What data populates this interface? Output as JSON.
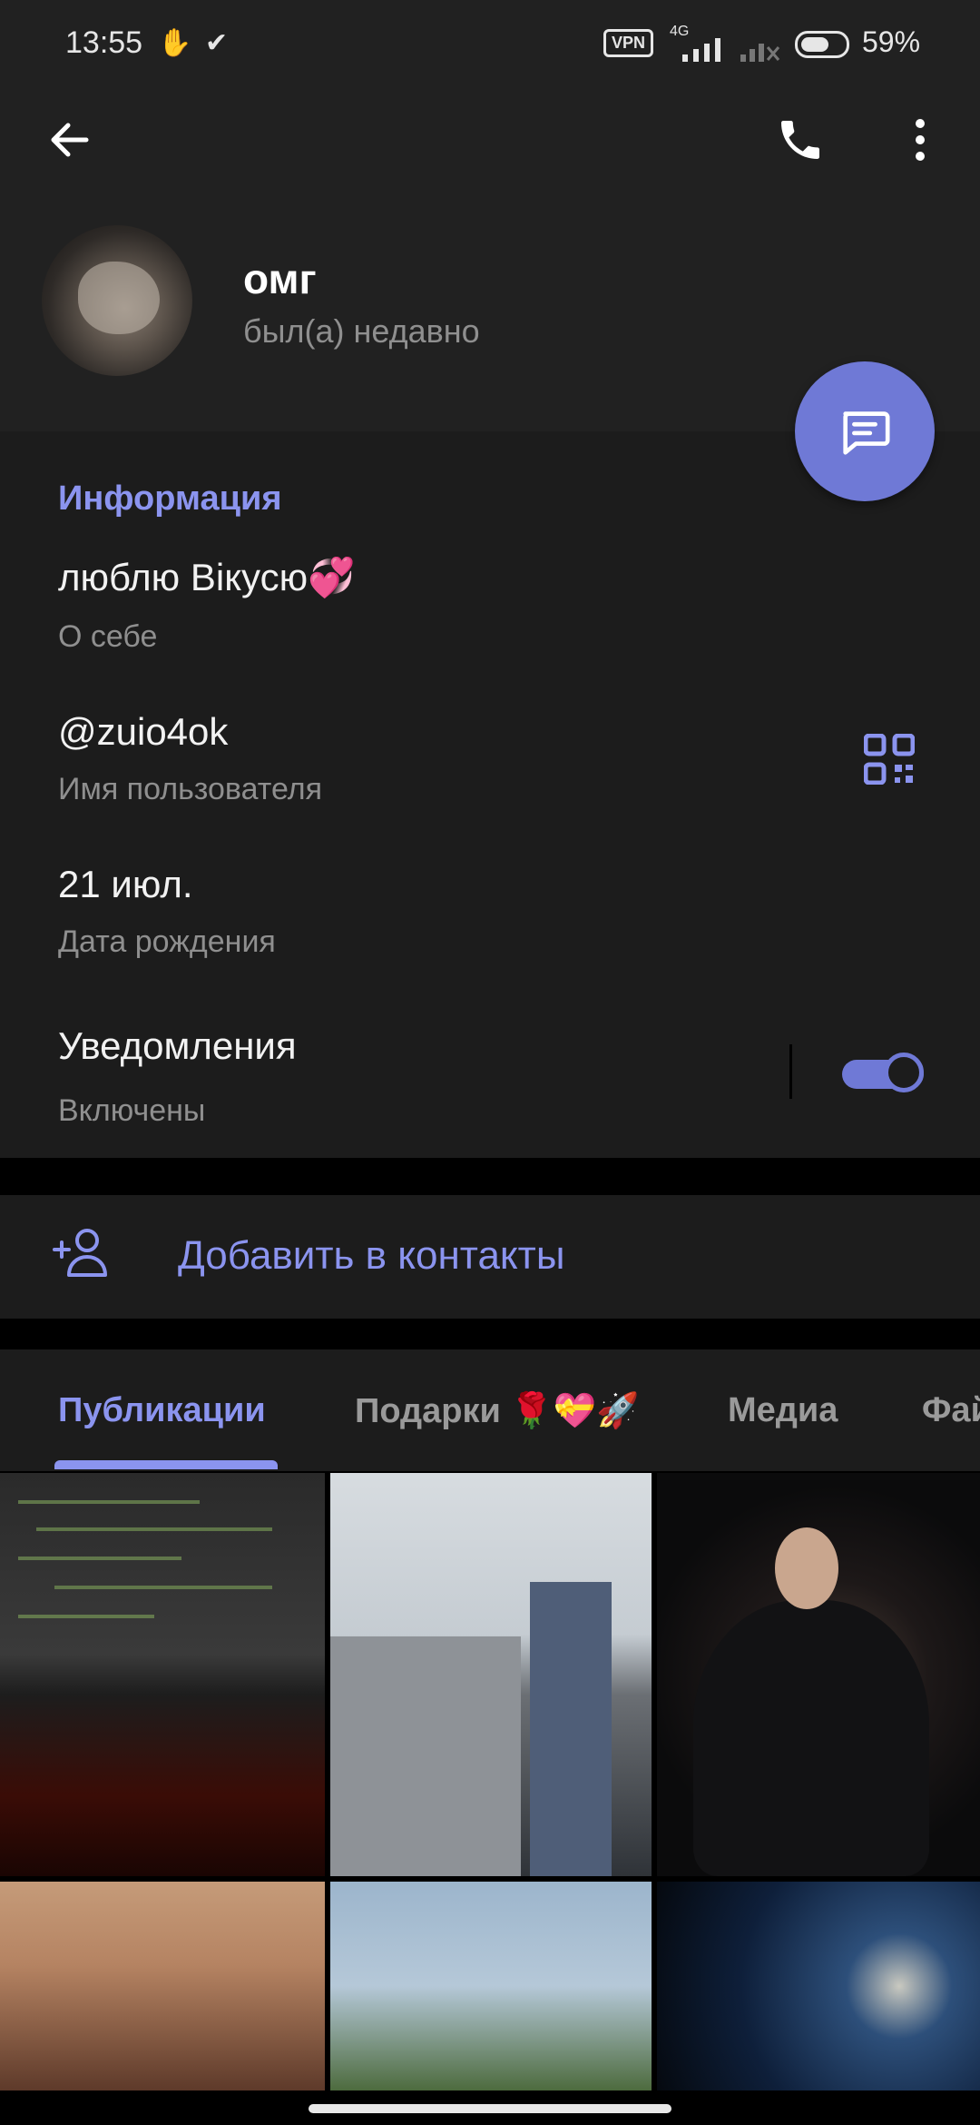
{
  "status_bar": {
    "time": "13:55",
    "vpn": "VPN",
    "network": "4G",
    "battery": "59%"
  },
  "header": {
    "name": "омг",
    "last_seen": "был(а) недавно"
  },
  "info": {
    "title": "Информация",
    "bio": "люблю Вікусю💞",
    "bio_label": "О себе",
    "username": "@zuio4ok",
    "username_label": "Имя пользователя",
    "birthday": "21 июл.",
    "birthday_label": "Дата рождения",
    "notifications": "Уведомления",
    "notifications_state": "Включены",
    "notifications_on": true
  },
  "actions": {
    "add_contact": "Добавить в контакты"
  },
  "tabs": [
    {
      "label": "Публикации",
      "active": true
    },
    {
      "label": "Подарки 🌹💝🚀",
      "active": false
    },
    {
      "label": "Медиа",
      "active": false
    },
    {
      "label": "Фай",
      "active": false
    }
  ],
  "colors": {
    "accent": "#8b94ef",
    "fab": "#6f79d6",
    "card": "#1c1c1c",
    "header": "#212121"
  }
}
